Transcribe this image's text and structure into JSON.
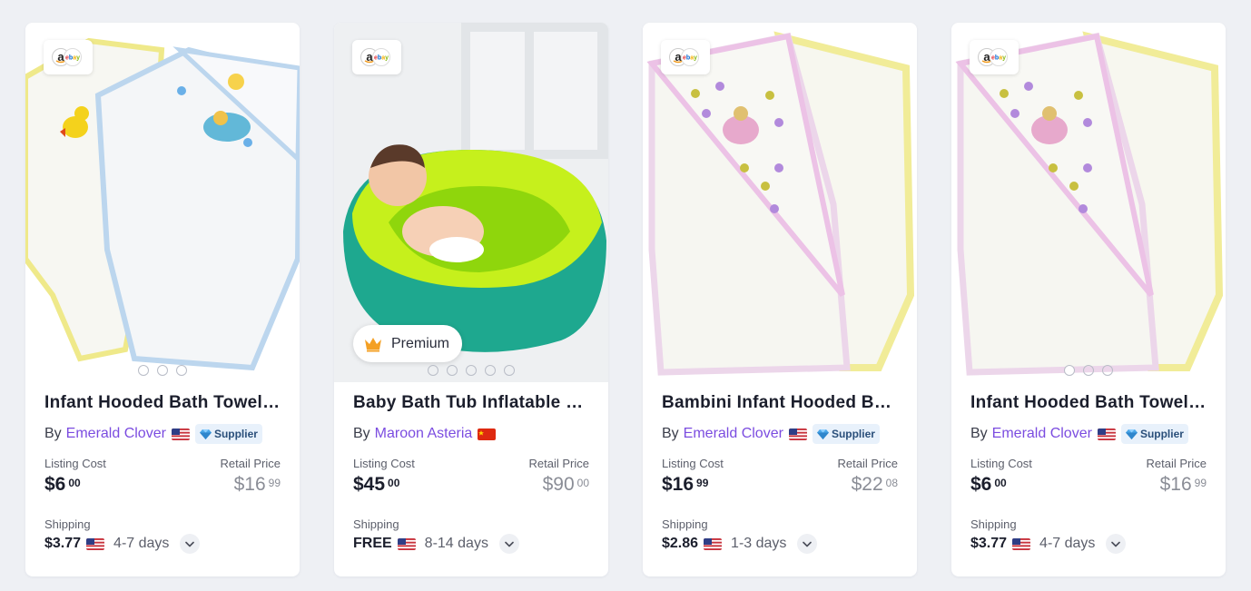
{
  "cards": [
    {
      "title": "Infant Hooded Bath Towel (...",
      "by_label": "By",
      "seller": "Emerald Clover",
      "seller_flag": "us-flag",
      "supplier_label": "Supplier",
      "marketplaces": "amazon-ebay",
      "image_dots": 3,
      "listing_cost_label": "Listing Cost",
      "listing_cost_main": "$6",
      "listing_cost_cents": "00",
      "retail_price_label": "Retail Price",
      "retail_price_main": "$16",
      "retail_price_cents": "99",
      "shipping_label": "Shipping",
      "shipping_cost": "$3.77",
      "shipping_flag": "us-flag",
      "shipping_days": "4-7 days"
    },
    {
      "title": "Baby Bath Tub Inflatable Ba...",
      "by_label": "By",
      "seller": "Maroon Asteria",
      "seller_flag": "cn-flag",
      "marketplaces": "amazon-ebay",
      "premium_label": "Premium",
      "image_dots": 5,
      "listing_cost_label": "Listing Cost",
      "listing_cost_main": "$45",
      "listing_cost_cents": "00",
      "retail_price_label": "Retail Price",
      "retail_price_main": "$90",
      "retail_price_cents": "00",
      "shipping_label": "Shipping",
      "shipping_cost": "FREE",
      "shipping_flag": "us-flag",
      "shipping_days": "8-14 days"
    },
    {
      "title": "Bambini Infant Hooded Bat...",
      "by_label": "By",
      "seller": "Emerald Clover",
      "seller_flag": "us-flag",
      "supplier_label": "Supplier",
      "marketplaces": "amazon-ebay",
      "listing_cost_label": "Listing Cost",
      "listing_cost_main": "$16",
      "listing_cost_cents": "99",
      "retail_price_label": "Retail Price",
      "retail_price_main": "$22",
      "retail_price_cents": "08",
      "shipping_label": "Shipping",
      "shipping_cost": "$2.86",
      "shipping_flag": "us-flag",
      "shipping_days": "1-3 days"
    },
    {
      "title": "Infant Hooded Bath Towel (...",
      "by_label": "By",
      "seller": "Emerald Clover",
      "seller_flag": "us-flag",
      "supplier_label": "Supplier",
      "marketplaces": "amazon-ebay",
      "image_dots": 3,
      "listing_cost_label": "Listing Cost",
      "listing_cost_main": "$6",
      "listing_cost_cents": "00",
      "retail_price_label": "Retail Price",
      "retail_price_main": "$16",
      "retail_price_cents": "99",
      "shipping_label": "Shipping",
      "shipping_cost": "$3.77",
      "shipping_flag": "us-flag",
      "shipping_days": "4-7 days"
    }
  ],
  "colors": {
    "seller_link": "#7b4ce0",
    "supplier_badge_bg": "#e8f1fb",
    "page_bg": "#eef0f4"
  }
}
